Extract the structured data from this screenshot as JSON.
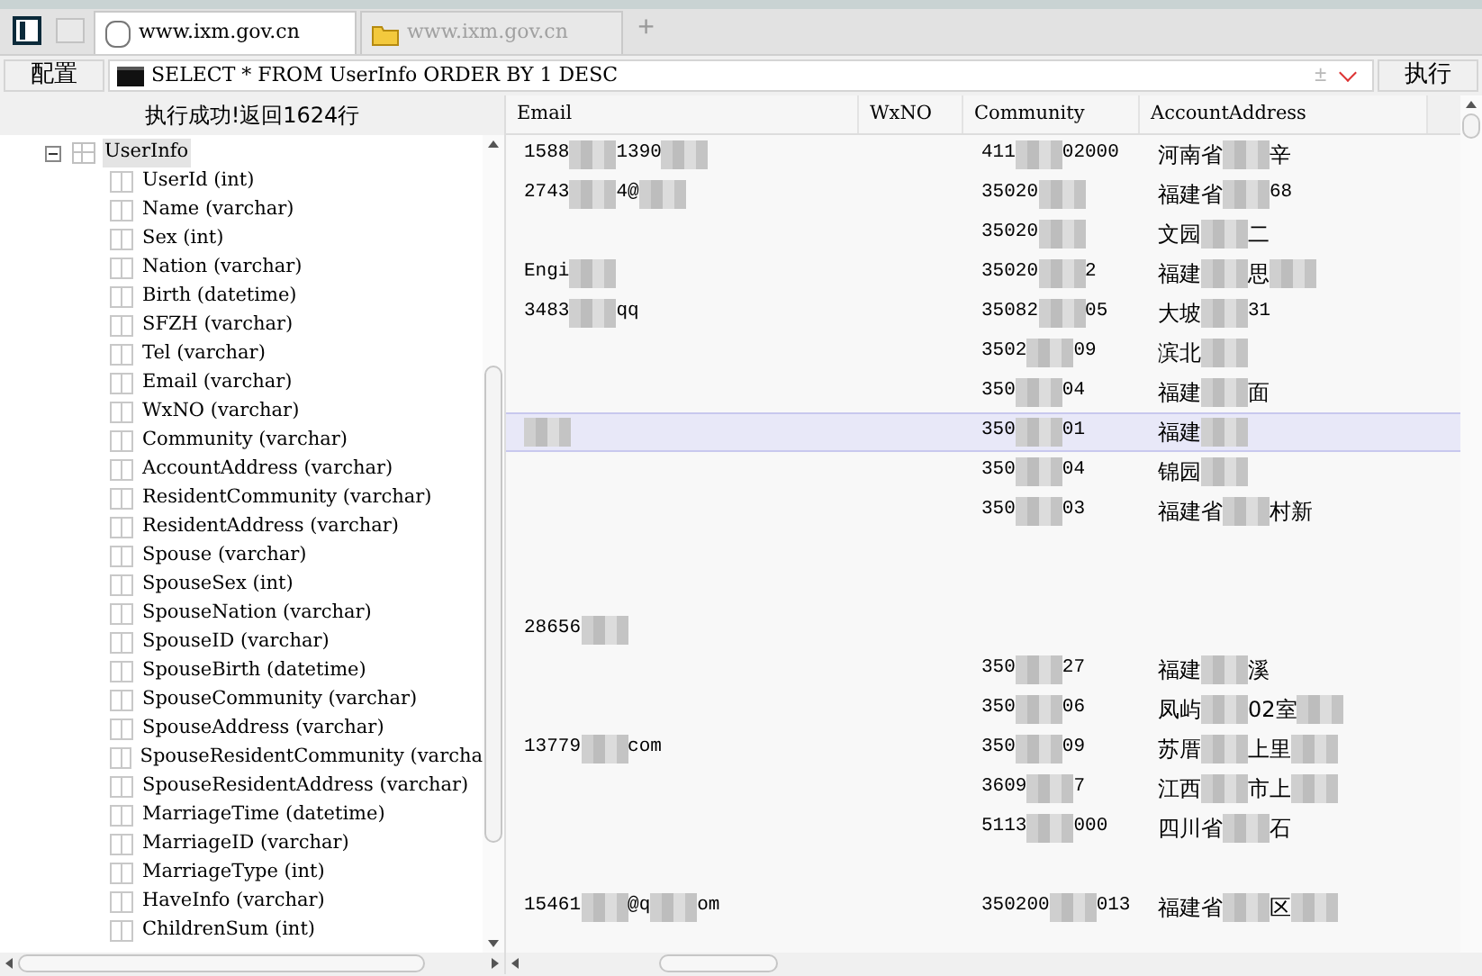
{
  "tabs": [
    {
      "label": "www.ixm.gov.cn",
      "kind": "database",
      "selected": true
    },
    {
      "label": "www.ixm.gov.cn",
      "kind": "folder",
      "selected": false
    }
  ],
  "new_tab": "+",
  "query_bar": {
    "config_button": "配置",
    "query": "SELECT * FROM UserInfo ORDER BY 1 DESC",
    "toggle": "±",
    "run_button": "执行"
  },
  "status": "执行成功!返回1624行",
  "tree": {
    "label": "UserInfo",
    "expanded": true,
    "selected": true,
    "children": [
      {
        "label": "UserId (int)"
      },
      {
        "label": "Name (varchar)"
      },
      {
        "label": "Sex (int)"
      },
      {
        "label": "Nation (varchar)"
      },
      {
        "label": "Birth (datetime)"
      },
      {
        "label": "SFZH (varchar)"
      },
      {
        "label": "Tel (varchar)"
      },
      {
        "label": "Email (varchar)"
      },
      {
        "label": "WxNO (varchar)"
      },
      {
        "label": "Community (varchar)"
      },
      {
        "label": "AccountAddress (varchar)"
      },
      {
        "label": "ResidentCommunity (varchar)"
      },
      {
        "label": "ResidentAddress (varchar)"
      },
      {
        "label": "Spouse (varchar)"
      },
      {
        "label": "SpouseSex (int)"
      },
      {
        "label": "SpouseNation (varchar)"
      },
      {
        "label": "SpouseID (varchar)"
      },
      {
        "label": "SpouseBirth (datetime)"
      },
      {
        "label": "SpouseCommunity (varchar)"
      },
      {
        "label": "SpouseAddress (varchar)"
      },
      {
        "label": "SpouseResidentCommunity (varcha"
      },
      {
        "label": "SpouseResidentAddress (varchar)"
      },
      {
        "label": "MarriageTime (datetime)"
      },
      {
        "label": "MarriageID (varchar)"
      },
      {
        "label": "MarriageType (int)"
      },
      {
        "label": "HaveInfo (varchar)"
      },
      {
        "label": "ChildrenSum (int)"
      }
    ]
  },
  "table": {
    "columns": [
      "Email",
      "WxNO",
      "Community",
      "AccountAddress"
    ],
    "rows": [
      {
        "selected": false,
        "cells": [
          [
            {
              "text": "1588"
            },
            {
              "kind": "mosaic"
            },
            {
              "text": "1390"
            },
            {
              "kind": "mosaic"
            }
          ],
          [],
          [
            {
              "text": "411"
            },
            {
              "kind": "mosaic"
            },
            {
              "text": "02000"
            }
          ],
          [
            {
              "text": "河南省"
            },
            {
              "kind": "mosaic"
            },
            {
              "text": "辛"
            }
          ]
        ]
      },
      {
        "selected": false,
        "cells": [
          [
            {
              "text": "2743"
            },
            {
              "kind": "mosaic"
            },
            {
              "text": "4@"
            },
            {
              "kind": "mosaic"
            }
          ],
          [],
          [
            {
              "text": "35020"
            },
            {
              "kind": "mosaic"
            }
          ],
          [
            {
              "text": "福建省"
            },
            {
              "kind": "mosaic"
            },
            {
              "text": "68"
            }
          ]
        ]
      },
      {
        "selected": false,
        "cells": [
          [],
          [],
          [
            {
              "text": "35020"
            },
            {
              "kind": "mosaic"
            }
          ],
          [
            {
              "text": "文园"
            },
            {
              "kind": "mosaic"
            },
            {
              "text": "二"
            }
          ]
        ]
      },
      {
        "selected": false,
        "cells": [
          [
            {
              "text": "Engi"
            },
            {
              "kind": "mosaic"
            }
          ],
          [],
          [
            {
              "text": "35020"
            },
            {
              "kind": "mosaic"
            },
            {
              "text": "2"
            }
          ],
          [
            {
              "text": "福建"
            },
            {
              "kind": "mosaic"
            },
            {
              "text": "思"
            },
            {
              "kind": "mosaic"
            }
          ]
        ]
      },
      {
        "selected": false,
        "cells": [
          [
            {
              "text": "3483"
            },
            {
              "kind": "mosaic"
            },
            {
              "text": "qq"
            }
          ],
          [],
          [
            {
              "text": "35082"
            },
            {
              "kind": "mosaic"
            },
            {
              "text": "05"
            }
          ],
          [
            {
              "text": "大坡"
            },
            {
              "kind": "mosaic"
            },
            {
              "text": "31"
            }
          ]
        ]
      },
      {
        "selected": false,
        "cells": [
          [],
          [],
          [
            {
              "text": "3502"
            },
            {
              "kind": "mosaic"
            },
            {
              "text": "09"
            }
          ],
          [
            {
              "text": "滨北"
            },
            {
              "kind": "mosaic"
            }
          ]
        ]
      },
      {
        "selected": false,
        "cells": [
          [],
          [],
          [
            {
              "text": "350"
            },
            {
              "kind": "mosaic"
            },
            {
              "text": "04"
            }
          ],
          [
            {
              "text": "福建"
            },
            {
              "kind": "mosaic"
            },
            {
              "text": "面"
            }
          ]
        ]
      },
      {
        "selected": true,
        "cells": [
          [
            {
              "kind": "mosaic"
            }
          ],
          [],
          [
            {
              "text": "350"
            },
            {
              "kind": "mosaic"
            },
            {
              "text": "01"
            }
          ],
          [
            {
              "text": "福建"
            },
            {
              "kind": "mosaic"
            }
          ]
        ]
      },
      {
        "selected": false,
        "cells": [
          [],
          [],
          [
            {
              "text": "350"
            },
            {
              "kind": "mosaic"
            },
            {
              "text": "04"
            }
          ],
          [
            {
              "text": "锦园"
            },
            {
              "kind": "mosaic"
            }
          ]
        ]
      },
      {
        "selected": false,
        "cells": [
          [],
          [],
          [
            {
              "text": "350"
            },
            {
              "kind": "mosaic"
            },
            {
              "text": "03"
            }
          ],
          [
            {
              "text": "福建省"
            },
            {
              "kind": "mosaic"
            },
            {
              "text": "村新"
            }
          ]
        ]
      },
      {
        "selected": false,
        "cells": [
          [],
          [],
          [],
          []
        ]
      },
      {
        "selected": false,
        "cells": [
          [],
          [],
          [],
          []
        ]
      },
      {
        "selected": false,
        "cells": [
          [
            {
              "text": "28656"
            },
            {
              "kind": "mosaic"
            }
          ],
          [],
          [],
          []
        ]
      },
      {
        "selected": false,
        "cells": [
          [],
          [],
          [
            {
              "text": "350"
            },
            {
              "kind": "mosaic"
            },
            {
              "text": "27"
            }
          ],
          [
            {
              "text": "福建"
            },
            {
              "kind": "mosaic"
            },
            {
              "text": "溪"
            }
          ]
        ]
      },
      {
        "selected": false,
        "cells": [
          [],
          [],
          [
            {
              "text": "350"
            },
            {
              "kind": "mosaic"
            },
            {
              "text": "06"
            }
          ],
          [
            {
              "text": "凤屿"
            },
            {
              "kind": "mosaic"
            },
            {
              "text": "02室"
            },
            {
              "kind": "mosaic"
            }
          ]
        ]
      },
      {
        "selected": false,
        "cells": [
          [
            {
              "text": "13779"
            },
            {
              "kind": "mosaic"
            },
            {
              "text": "com"
            }
          ],
          [],
          [
            {
              "text": "350"
            },
            {
              "kind": "mosaic"
            },
            {
              "text": "09"
            }
          ],
          [
            {
              "text": "苏厝"
            },
            {
              "kind": "mosaic"
            },
            {
              "text": "上里"
            },
            {
              "kind": "mosaic"
            }
          ]
        ]
      },
      {
        "selected": false,
        "cells": [
          [],
          [],
          [
            {
              "text": "3609"
            },
            {
              "kind": "mosaic"
            },
            {
              "text": "7"
            }
          ],
          [
            {
              "text": "江西"
            },
            {
              "kind": "mosaic"
            },
            {
              "text": "市上"
            },
            {
              "kind": "mosaic"
            }
          ]
        ]
      },
      {
        "selected": false,
        "cells": [
          [],
          [],
          [
            {
              "text": "5113"
            },
            {
              "kind": "mosaic"
            },
            {
              "text": "000"
            }
          ],
          [
            {
              "text": "四川省"
            },
            {
              "kind": "mosaic"
            },
            {
              "text": "石"
            }
          ]
        ]
      },
      {
        "selected": false,
        "cells": [
          [],
          [],
          [],
          []
        ]
      },
      {
        "selected": false,
        "cells": [
          [
            {
              "text": "15461"
            },
            {
              "kind": "mosaic"
            },
            {
              "text": "@q"
            },
            {
              "kind": "mosaic"
            },
            {
              "text": "om"
            }
          ],
          [],
          [
            {
              "text": "350200"
            },
            {
              "kind": "mosaic"
            },
            {
              "text": "013"
            }
          ],
          [
            {
              "text": "福建省"
            },
            {
              "kind": "mosaic"
            },
            {
              "text": "区"
            },
            {
              "kind": "mosaic"
            }
          ]
        ]
      }
    ]
  }
}
